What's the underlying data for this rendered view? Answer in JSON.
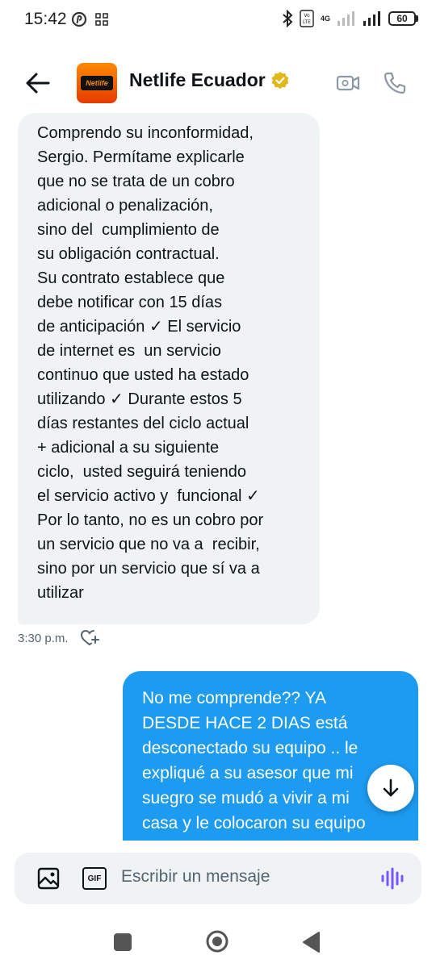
{
  "status": {
    "time": "15:42",
    "network": "4G",
    "battery": "60"
  },
  "header": {
    "contact_name": "Netlife Ecuador",
    "avatar_text": "Netlife"
  },
  "messages": {
    "incoming": {
      "text": "Comprendo su inconformidad,\nSergio. Permítame explicarle\nque no se trata de un cobro\nadicional o penalización,\nsino del  cumplimiento de\nsu obligación contractual.\nSu contrato establece que\ndebe notificar con 15 días\nde anticipación ✓ El servicio\nde internet es  un servicio\ncontinuo que usted ha estado\nutilizando ✓ Durante estos 5\ndías restantes del ciclo actual\n+ adicional a su siguiente\nciclo,  usted seguirá teniendo\nel servicio activo y  funcional ✓\nPor lo tanto, no es un cobro por\nun servicio que no va a  recibir,\nsino por un servicio que sí va a\nutilizar",
      "time": "3:30 p.m."
    },
    "outgoing": {
      "text": "No me comprende?? YA\nDESDE HACE 2 DIAS está\ndesconectado su equipo .. le\nexpliqué a su asesor que mi\nsuegro se mudó a vivir a mi\ncasa y le colocaron su equipo\npor el momento. No lo"
    }
  },
  "composer": {
    "placeholder": "Escribir un mensaje",
    "gif_label": "GIF"
  },
  "colors": {
    "accent": "#1d9bf0",
    "bubble_in": "#eff3f4",
    "voice": "#7856ff",
    "verified_gold": "#e2b719"
  }
}
